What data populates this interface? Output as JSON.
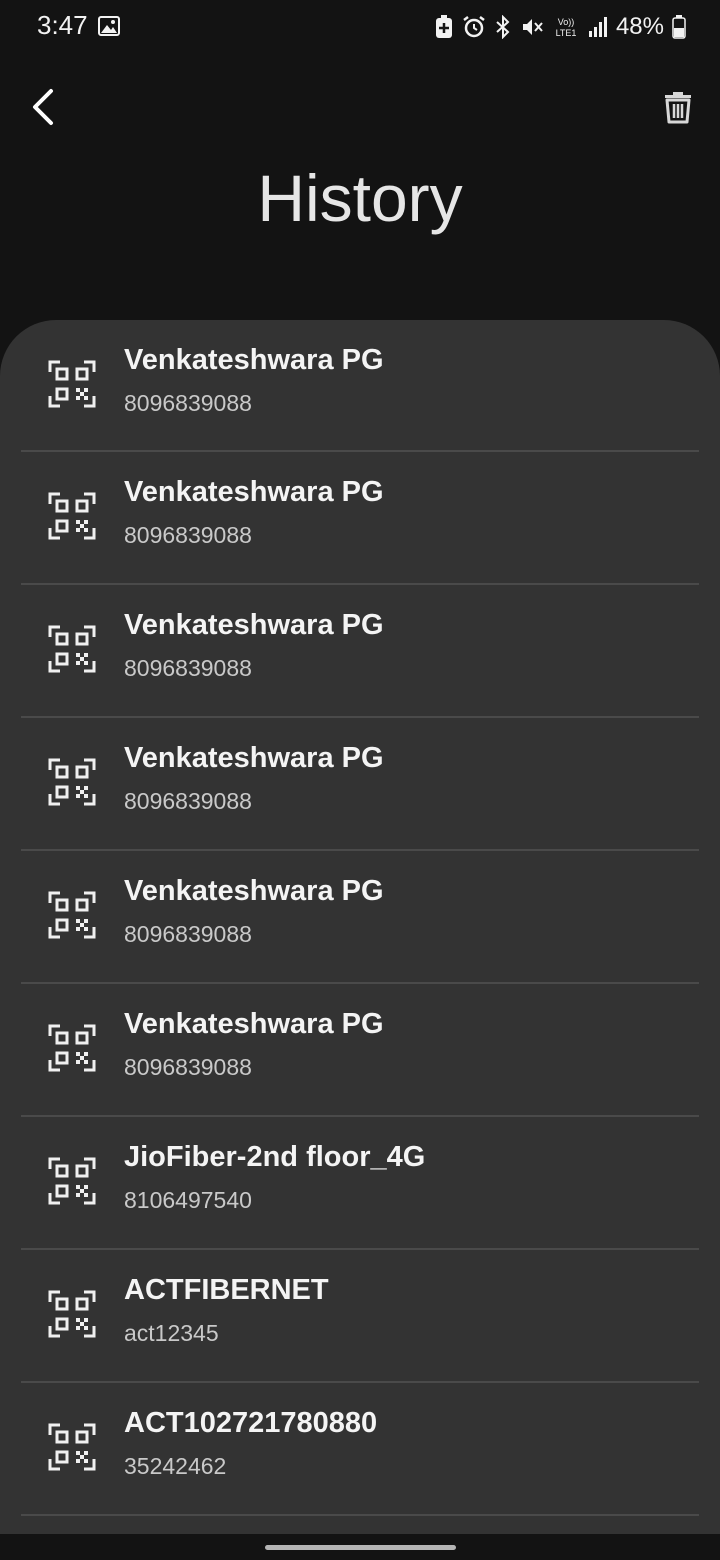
{
  "status_bar": {
    "time": "3:47",
    "battery_text": "48%",
    "icons": [
      "gallery-icon",
      "battery-saver-icon",
      "alarm-icon",
      "bluetooth-icon",
      "mute-icon",
      "volte-icon",
      "signal-icon",
      "battery-icon"
    ],
    "volte_label_top": "Vo))",
    "volte_label_bottom": "LTE1"
  },
  "header": {
    "title": "History",
    "back_icon": "chevron-left-icon",
    "delete_icon": "trash-icon"
  },
  "history": {
    "items": [
      {
        "name": "Venkateshwara PG",
        "detail": "8096839088"
      },
      {
        "name": "Venkateshwara PG",
        "detail": "8096839088"
      },
      {
        "name": "Venkateshwara PG",
        "detail": "8096839088"
      },
      {
        "name": "Venkateshwara PG",
        "detail": "8096839088"
      },
      {
        "name": "Venkateshwara PG",
        "detail": "8096839088"
      },
      {
        "name": "Venkateshwara PG",
        "detail": "8096839088"
      },
      {
        "name": "JioFiber-2nd floor_4G",
        "detail": "8106497540"
      },
      {
        "name": "ACTFIBERNET",
        "detail": "act12345"
      },
      {
        "name": "ACT102721780880",
        "detail": "35242462"
      }
    ]
  },
  "colors": {
    "background": "#131313",
    "sheet": "#333333",
    "divider": "#4a4a4a",
    "text_primary": "#f4f4f4",
    "text_secondary": "#c9c9c9"
  }
}
